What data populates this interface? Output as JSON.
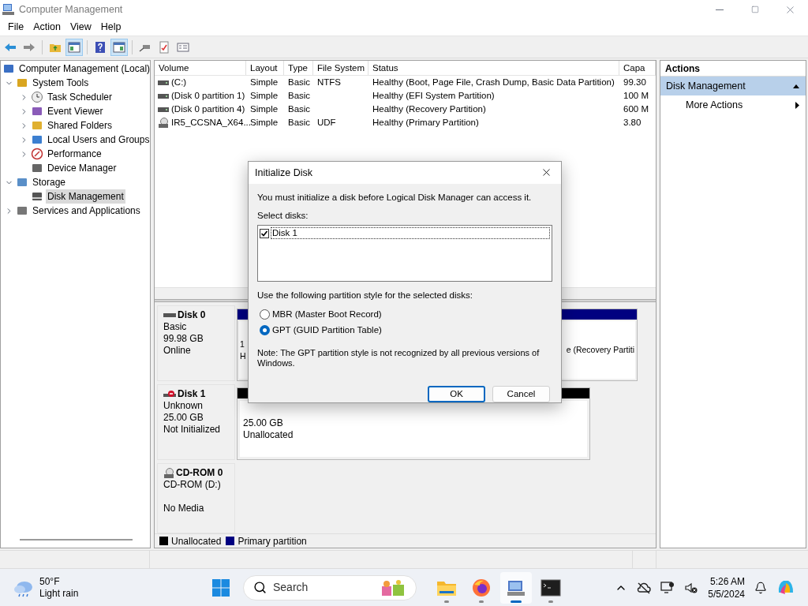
{
  "window": {
    "title": "Computer Management"
  },
  "menu": [
    "File",
    "Action",
    "View",
    "Help"
  ],
  "toolbar": [
    {
      "pressed": false
    },
    {
      "pressed": false
    },
    {
      "pressed": false
    },
    {
      "pressed": true
    },
    {
      "pressed": false
    },
    {
      "pressed": true
    },
    {
      "pressed": false
    },
    {
      "pressed": false
    },
    {
      "pressed": false
    }
  ],
  "tree": [
    {
      "label": "Computer Management (Local)",
      "selected": false,
      "children": [
        {
          "label": "System Tools",
          "selected": false,
          "expanded": true,
          "children": [
            {
              "label": "Task Scheduler",
              "selected": false,
              "expanded": false
            },
            {
              "label": "Event Viewer",
              "selected": false,
              "expanded": false
            },
            {
              "label": "Shared Folders",
              "selected": false,
              "expanded": false
            },
            {
              "label": "Local Users and Groups",
              "selected": false,
              "expanded": false
            },
            {
              "label": "Performance",
              "selected": false,
              "expanded": false
            },
            {
              "label": "Device Manager",
              "selected": false
            }
          ]
        },
        {
          "label": "Storage",
          "selected": false,
          "expanded": true,
          "children": [
            {
              "label": "Disk Management",
              "selected": true
            }
          ]
        },
        {
          "label": "Services and Applications",
          "selected": false,
          "expanded": false
        }
      ]
    }
  ],
  "table": {
    "columns": [
      "Volume",
      "Layout",
      "Type",
      "File System",
      "Status",
      "Capa"
    ],
    "rows": [
      {
        "kind": "volume",
        "cells": [
          "(C:)",
          "Simple",
          "Basic",
          "NTFS",
          "Healthy (Boot, Page File, Crash Dump, Basic Data Partition)",
          "99.30"
        ]
      },
      {
        "kind": "volume",
        "cells": [
          "(Disk 0 partition 1)",
          "Simple",
          "Basic",
          "",
          "Healthy (EFI System Partition)",
          "100 M"
        ]
      },
      {
        "kind": "volume",
        "cells": [
          "(Disk 0 partition 4)",
          "Simple",
          "Basic",
          "",
          "Healthy (Recovery Partition)",
          "600 M"
        ]
      },
      {
        "kind": "cdrom",
        "cells": [
          "IR5_CCSNA_X64...",
          "Simple",
          "Basic",
          "UDF",
          "Healthy (Primary Partition)",
          "3.80"
        ]
      }
    ]
  },
  "disks": [
    {
      "kind": "disk",
      "name": "Disk 0",
      "error": false,
      "lines": [
        "Basic",
        "99.98 GB",
        "Online"
      ],
      "partitions": [
        {
          "color": "#000080",
          "lines": [
            "1",
            "H"
          ]
        },
        {
          "color": "#000080",
          "lines": [
            "e (Recovery Partiti"
          ]
        }
      ]
    },
    {
      "kind": "disk",
      "name": "Disk 1",
      "error": true,
      "lines": [
        "Unknown",
        "25.00 GB",
        "Not Initialized"
      ],
      "partitions": [
        {
          "color": "#000000",
          "lines": [
            "25.00 GB",
            "Unallocated"
          ]
        }
      ]
    },
    {
      "kind": "cdrom",
      "name": "CD-ROM 0",
      "lines": [
        "CD-ROM (D:)",
        "No Media"
      ]
    }
  ],
  "legend": [
    {
      "label": "Unallocated",
      "color": "#000000"
    },
    {
      "label": "Primary partition",
      "color": "#000080"
    }
  ],
  "actions": {
    "title": "Actions",
    "items": [
      {
        "label": "Disk Management",
        "kind": "section",
        "selected": true
      },
      {
        "label": "More Actions",
        "kind": "submenu",
        "selected": false
      }
    ]
  },
  "dialog": {
    "title": "Initialize Disk",
    "message": "You must initialize a disk before Logical Disk Manager can access it.",
    "list_label": "Select disks:",
    "disks": [
      {
        "label": "Disk 1",
        "checked": true
      }
    ],
    "style_label": "Use the following partition style for the selected disks:",
    "styles": [
      {
        "label": "MBR (Master Boot Record)",
        "selected": false
      },
      {
        "label": "GPT (GUID Partition Table)",
        "selected": true
      }
    ],
    "note": "Note: The GPT partition style is not recognized by all previous versions of Windows.",
    "buttons": [
      {
        "label": "OK",
        "default": true
      },
      {
        "label": "Cancel",
        "default": false
      }
    ]
  },
  "taskbar": {
    "weather": {
      "temp": "50°F",
      "text": "Light rain"
    },
    "search": {
      "placeholder": "Search"
    },
    "apps": [
      {
        "selected": false
      },
      {
        "selected": false
      },
      {
        "selected": true
      },
      {
        "selected": false
      }
    ],
    "time": "5:26 AM",
    "date": "5/5/2024"
  }
}
